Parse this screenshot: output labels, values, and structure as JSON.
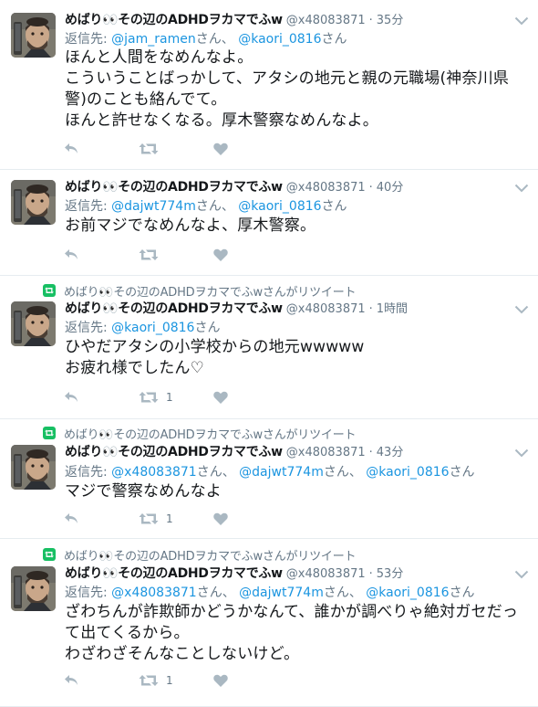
{
  "retweet_label": "めばり👀その辺のADHDヲカマでふwさんがリツイート",
  "tweets": [
    {
      "name": "めばり👀その辺のADHDヲカマでふw",
      "handle": "@x48083871",
      "time": "35分",
      "reply_prefix": "返信先:",
      "reply_to": [
        {
          "handle": "@jam_ramen",
          "suffix": "さん、"
        },
        {
          "handle": "@kaori_0816",
          "suffix": "さん"
        }
      ],
      "text": "ほんと人間をなめんなよ。\nこういうことばっかして、アタシの地元と親の元職場(神奈川県警)のことも絡んでて。\nほんと許せなくなる。厚木警察なめんなよ。",
      "retweet_count": "",
      "retweeted": false
    },
    {
      "name": "めばり👀その辺のADHDヲカマでふw",
      "handle": "@x48083871",
      "time": "40分",
      "reply_prefix": "返信先:",
      "reply_to": [
        {
          "handle": "@dajwt774m",
          "suffix": "さん、"
        },
        {
          "handle": "@kaori_0816",
          "suffix": "さん"
        }
      ],
      "text": "お前マジでなめんなよ、厚木警察。",
      "retweet_count": "",
      "retweeted": false
    },
    {
      "name": "めばり👀その辺のADHDヲカマでふw",
      "handle": "@x48083871",
      "time": "1時間",
      "reply_prefix": "返信先:",
      "reply_to": [
        {
          "handle": "@kaori_0816",
          "suffix": "さん"
        }
      ],
      "text": "ひやだアタシの小学校からの地元wwwww\nお疲れ様でしたん♡",
      "retweet_count": "1",
      "retweeted": true
    },
    {
      "name": "めばり👀その辺のADHDヲカマでふw",
      "handle": "@x48083871",
      "time": "43分",
      "reply_prefix": "返信先:",
      "reply_to": [
        {
          "handle": "@x48083871",
          "suffix": "さん、"
        },
        {
          "handle": "@dajwt774m",
          "suffix": "さん、"
        },
        {
          "handle": "@kaori_0816",
          "suffix": "さん"
        }
      ],
      "text": "マジで警察なめんなよ",
      "retweet_count": "1",
      "retweeted": true
    },
    {
      "name": "めばり👀その辺のADHDヲカマでふw",
      "handle": "@x48083871",
      "time": "53分",
      "reply_prefix": "返信先:",
      "reply_to": [
        {
          "handle": "@x48083871",
          "suffix": "さん、"
        },
        {
          "handle": "@dajwt774m",
          "suffix": "さん、"
        },
        {
          "handle": "@kaori_0816",
          "suffix": "さん"
        }
      ],
      "text": "ざわちんが詐欺師かどうかなんて、誰かが調べりゃ絶対ガセだって出てくるから。\nわざわざそんなことしないけど。",
      "retweet_count": "1",
      "retweeted": true
    }
  ],
  "icons": {
    "reply": "reply-icon",
    "retweet": "retweet-icon",
    "like": "heart-icon",
    "more": "chevron-down-icon",
    "retweeted_marker": "retweet-icon"
  },
  "colors": {
    "link": "#1b95e0",
    "meta": "#657786",
    "text": "#14171a",
    "icon": "#aab8c2",
    "retweet_green": "#17bf63",
    "divider": "#e6ecf0"
  }
}
